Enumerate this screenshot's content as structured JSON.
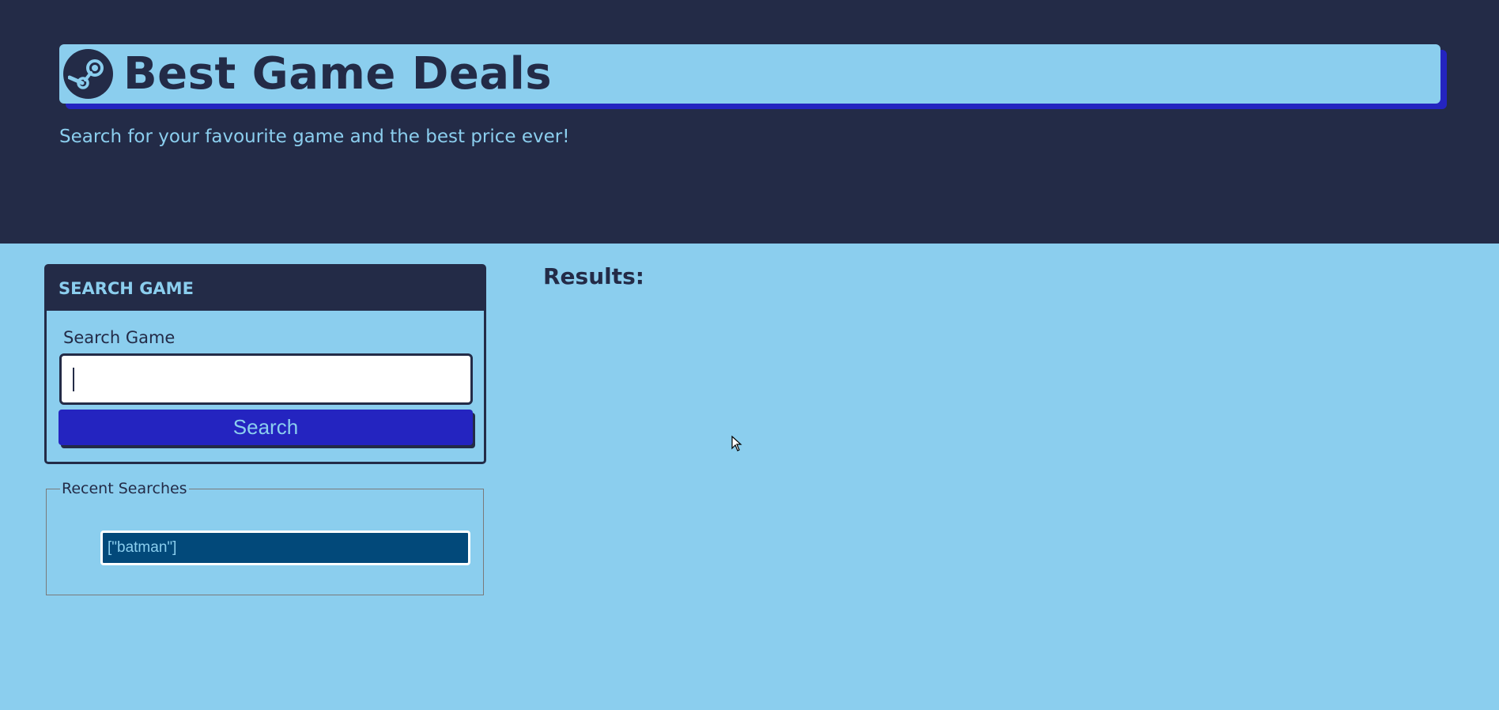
{
  "header": {
    "logo_icon": "steam-logo-icon",
    "title": "Best Game Deals",
    "subtitle": "Search for your favourite game and the best price ever!"
  },
  "search_card": {
    "header": "SEARCH GAME",
    "field_label": "Search Game",
    "input_value": "",
    "button_label": "Search"
  },
  "recent_searches": {
    "legend": "Recent Searches",
    "items": [
      "[\"batman\"]"
    ]
  },
  "results": {
    "heading": "Results:"
  },
  "colors": {
    "dark_navy": "#232b47",
    "light_blue": "#8bceee",
    "button_blue": "#2424c0",
    "recent_item_blue": "#02497a"
  }
}
